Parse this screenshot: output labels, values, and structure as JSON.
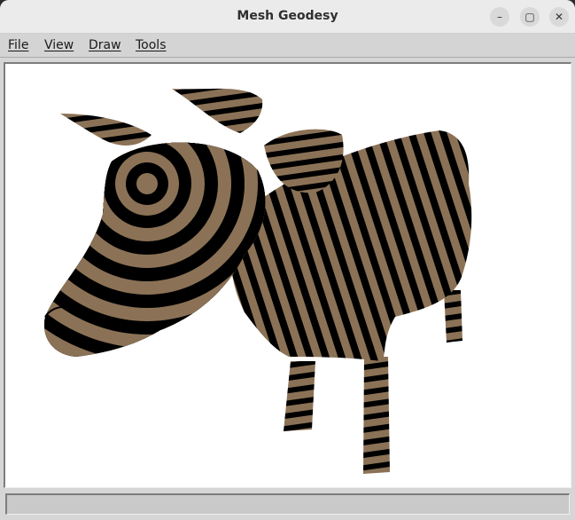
{
  "window": {
    "title": "Mesh Geodesy",
    "controls": {
      "minimize": "–",
      "maximize": "▢",
      "close": "✕"
    }
  },
  "menu": {
    "file": "File",
    "view": "View",
    "draw": "Draw",
    "tools": "Tools"
  },
  "viewport": {
    "background": "#ffffff",
    "mesh_color": "#8b7256",
    "stripe_color": "#000000"
  },
  "status": {
    "text": ""
  }
}
